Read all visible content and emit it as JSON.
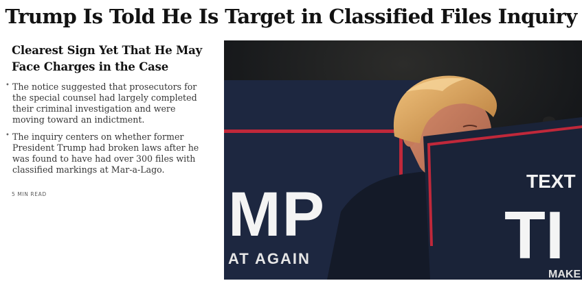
{
  "headline": "Trump Is Told He Is Target in Classified Files Inquiry",
  "story": {
    "subheadline": "Clearest Sign Yet That He May Face Charges in the Case",
    "bullets": [
      "The notice suggested that prosecutors for the special counsel had largely completed their criminal investigation and were moving toward an indictment.",
      "The inquiry centers on whether former President Trump had broken laws after he was found to have had over 300 files with classified markings at Mar-a-Lago."
    ],
    "read_time": "5 MIN READ"
  },
  "photo": {
    "sign_left_text": "MP",
    "sign_left_subtext": "AT AGAIN",
    "sign_right_small": "TEXT",
    "sign_right_big": "TI",
    "sign_right_bottom": "MAKE",
    "colors": {
      "navy": "#1a2338",
      "red": "#c0283a",
      "hair": "#d9a25a"
    }
  }
}
